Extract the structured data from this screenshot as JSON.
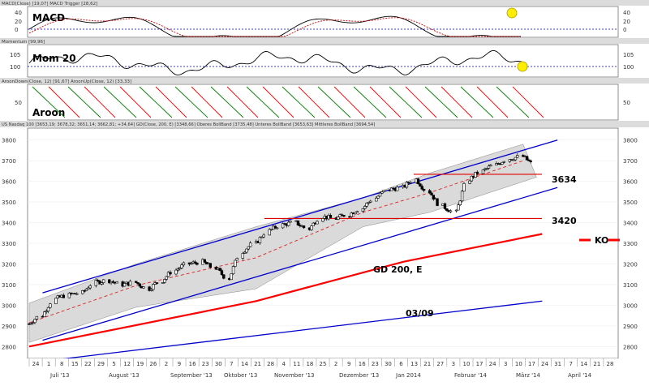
{
  "colors": {
    "panel_bg": "#ffffff",
    "frame": "#707070",
    "header_bg": "#dcdcdc",
    "price_line": "#000000",
    "bollinger_fill": "#d3d3d3",
    "channel": "#0000cc",
    "gd200": "#ff0000",
    "trendline_red": "#e00000",
    "macd": "#000000",
    "trigger": "#cc0000",
    "aroon_up": "#008000",
    "aroon_down": "#ff0000",
    "marker": "#ffee00"
  },
  "panels": {
    "macd": {
      "header": "MACD(Close) [19,07]  MACD Trigger [28,62]",
      "label": "MACD",
      "ticks": [
        "40",
        "20",
        "0"
      ]
    },
    "momentum": {
      "header": "Momentum [99,96]",
      "label": "Mom 20",
      "ticks": [
        "105",
        "100"
      ]
    },
    "aroon": {
      "header": "AroonDown(Close, 12) [91,67]  AroonUp(Close, 12) [33,33]",
      "label": "Aroon",
      "ticks": [
        "50"
      ]
    },
    "price": {
      "header": "US Nasdaq 100 [3653,19; 3678,32; 3651,14; 3662,81; +34,64]  GD(Close, 200, E) [3348,66]  Oberes BollBand [3735,48]  Unteres BollBand [3653,63]  Mittleres BollBand [3694,54]",
      "annotations": {
        "level_upper": "3634",
        "level_lower": "3420",
        "gd_label": "GD 200, E",
        "lower_channel_label": "03/09",
        "ko_label": "KO"
      }
    }
  },
  "x_axis": {
    "day_labels": [
      "24",
      "1",
      "8",
      "15",
      "22",
      "29",
      "5",
      "12",
      "19",
      "26",
      "2",
      "9",
      "16",
      "23",
      "30",
      "7",
      "14",
      "21",
      "28",
      "4",
      "11",
      "18",
      "25",
      "2",
      "9",
      "16",
      "23",
      "30",
      "6",
      "13",
      "21",
      "27",
      "3",
      "10",
      "17",
      "24",
      "3",
      "10",
      "17",
      "24",
      "31",
      "7",
      "14",
      "21",
      "28"
    ],
    "month_labels": [
      "Juli '13",
      "August '13",
      "September '13",
      "Oktober '13",
      "November '13",
      "Dezember '13",
      "Jan 2014",
      "Februar '14",
      "März '14",
      "April '14"
    ]
  },
  "chart_data": {
    "type": "candlestick",
    "title": "US Nasdaq 100",
    "y_axis_ticks": [
      "3800",
      "3700",
      "3600",
      "3500",
      "3400",
      "3300",
      "3200",
      "3100",
      "3000",
      "2900",
      "2800"
    ],
    "ylim": [
      2750,
      3850
    ],
    "x_range": [
      "2013-06-24",
      "2014-04-28"
    ],
    "last_bar": {
      "open": 3653.19,
      "high": 3678.32,
      "low": 3651.14,
      "close": 3662.81,
      "change": 34.64
    },
    "closes_weekly": [
      [
        "2013-06-24",
        2910
      ],
      [
        "2013-07-01",
        2950
      ],
      [
        "2013-07-08",
        3030
      ],
      [
        "2013-07-15",
        3050
      ],
      [
        "2013-07-22",
        3060
      ],
      [
        "2013-07-29",
        3110
      ],
      [
        "2013-08-05",
        3120
      ],
      [
        "2013-08-12",
        3100
      ],
      [
        "2013-08-19",
        3110
      ],
      [
        "2013-08-26",
        3080
      ],
      [
        "2013-09-02",
        3120
      ],
      [
        "2013-09-09",
        3170
      ],
      [
        "2013-09-16",
        3200
      ],
      [
        "2013-09-23",
        3210
      ],
      [
        "2013-09-30",
        3180
      ],
      [
        "2013-10-07",
        3130
      ],
      [
        "2013-10-14",
        3260
      ],
      [
        "2013-10-21",
        3300
      ],
      [
        "2013-10-28",
        3360
      ],
      [
        "2013-11-04",
        3390
      ],
      [
        "2013-11-11",
        3400
      ],
      [
        "2013-11-18",
        3370
      ],
      [
        "2013-11-25",
        3430
      ],
      [
        "2013-12-02",
        3420
      ],
      [
        "2013-12-09",
        3440
      ],
      [
        "2013-12-16",
        3470
      ],
      [
        "2013-12-23",
        3520
      ],
      [
        "2013-12-30",
        3560
      ],
      [
        "2014-01-06",
        3570
      ],
      [
        "2014-01-13",
        3610
      ],
      [
        "2014-01-20",
        3550
      ],
      [
        "2014-01-27",
        3480
      ],
      [
        "2014-02-03",
        3450
      ],
      [
        "2014-02-10",
        3610
      ],
      [
        "2014-02-17",
        3650
      ],
      [
        "2014-02-24",
        3680
      ],
      [
        "2014-03-03",
        3710
      ],
      [
        "2014-03-10",
        3720
      ],
      [
        "2014-03-17",
        3680
      ]
    ],
    "gd200": [
      [
        "2013-06-24",
        2800
      ],
      [
        "2013-10-21",
        3020
      ],
      [
        "2014-01-06",
        3210
      ],
      [
        "2014-03-20",
        3345
      ]
    ],
    "bollinger_upper": [
      [
        "2013-06-24",
        3010
      ],
      [
        "2013-08-19",
        3200
      ],
      [
        "2013-10-21",
        3380
      ],
      [
        "2013-12-16",
        3520
      ],
      [
        "2014-01-20",
        3640
      ],
      [
        "2014-03-10",
        3780
      ]
    ],
    "bollinger_lower": [
      [
        "2013-06-24",
        2820
      ],
      [
        "2013-08-19",
        2990
      ],
      [
        "2013-10-21",
        3080
      ],
      [
        "2013-12-16",
        3380
      ],
      [
        "2014-01-20",
        3450
      ],
      [
        "2014-03-17",
        3620
      ]
    ],
    "upper_channel": [
      [
        "2013-07-01",
        3060
      ],
      [
        "2014-03-28",
        3800
      ]
    ],
    "middle_channel": [
      [
        "2013-07-01",
        2830
      ],
      [
        "2014-03-28",
        3570
      ]
    ],
    "lower_channel": [
      [
        "2013-06-24",
        2720
      ],
      [
        "2014-03-20",
        3020
      ]
    ],
    "horizontal_levels": [
      3634,
      3420
    ],
    "ko_level": 3330
  }
}
